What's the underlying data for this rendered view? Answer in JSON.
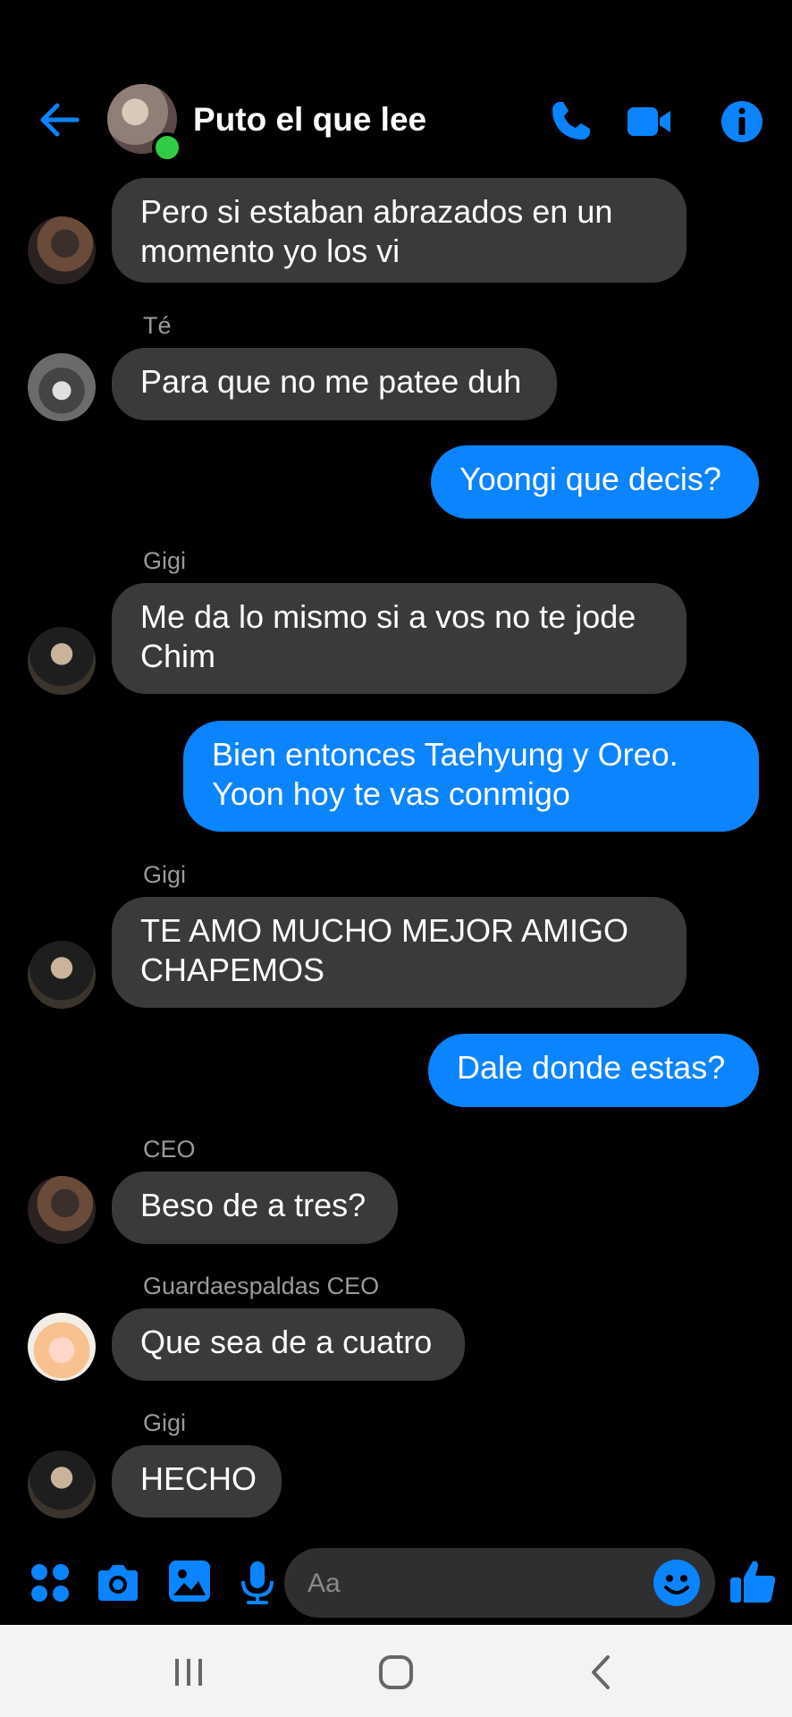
{
  "header": {
    "title": "Puto el que lee",
    "back_icon": "arrow-left-icon",
    "call_icon": "phone-icon",
    "video_icon": "video-camera-icon",
    "info_icon": "info-icon",
    "accent_color": "#0a84ff",
    "online_color": "#31cc46"
  },
  "messages": [
    {
      "side": "in",
      "sender": "",
      "text": "Pero si estaban abrazados en un momento yo los vi"
    },
    {
      "side": "in",
      "sender": "Té",
      "text": "Para que no me patee duh"
    },
    {
      "side": "out",
      "sender": "",
      "text": "Yoongi que decis?"
    },
    {
      "side": "in",
      "sender": "Gigi",
      "text": "Me da lo mismo si a vos no te jode Chim"
    },
    {
      "side": "out",
      "sender": "",
      "text": "Bien entonces Taehyung y Oreo. Yoon hoy te vas conmigo"
    },
    {
      "side": "in",
      "sender": "Gigi",
      "text": "TE AMO MUCHO MEJOR AMIGO CHAPEMOS"
    },
    {
      "side": "out",
      "sender": "",
      "text": "Dale donde estas?"
    },
    {
      "side": "in",
      "sender": "CEO",
      "text": "Beso de a tres?"
    },
    {
      "side": "in",
      "sender": "Guardaespaldas CEO",
      "text": "Que sea de a cuatro"
    },
    {
      "side": "in",
      "sender": "Gigi",
      "text": "HECHO"
    }
  ],
  "composer": {
    "placeholder": "Aa",
    "menu_icon": "apps-grid-icon",
    "camera_icon": "camera-icon",
    "gallery_icon": "image-icon",
    "mic_icon": "microphone-icon",
    "emoji_icon": "smiley-icon",
    "like_icon": "thumbs-up-icon"
  },
  "navbar": {
    "recent_icon": "recent-apps-icon",
    "home_icon": "home-icon",
    "back_icon": "chevron-left-icon"
  }
}
